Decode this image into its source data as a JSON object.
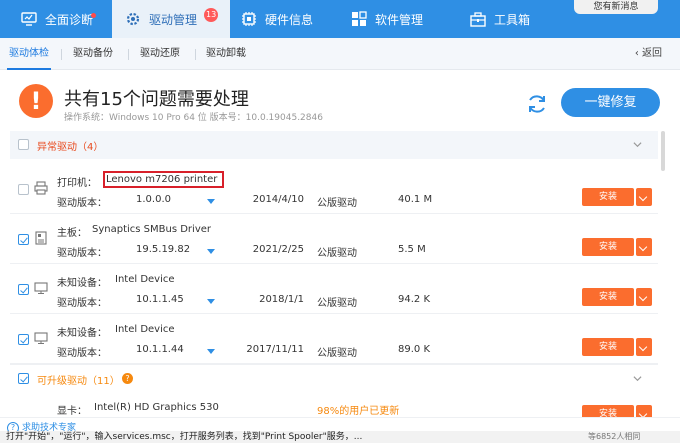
{
  "header": {
    "tabs": [
      {
        "label": "全面诊断",
        "icon": "monitor-icon"
      },
      {
        "label": "驱动管理",
        "icon": "gear-icon",
        "badge": "13"
      },
      {
        "label": "硬件信息",
        "icon": "chip-icon"
      },
      {
        "label": "软件管理",
        "icon": "grid-icon"
      },
      {
        "label": "工具箱",
        "icon": "toolbox-icon"
      }
    ],
    "message_button": "您有新消息"
  },
  "subnav": {
    "tabs": [
      "驱动体检",
      "驱动备份",
      "驱动还原",
      "驱动卸载"
    ],
    "active": "驱动体检",
    "back": "返回"
  },
  "summary": {
    "title": "共有15个问题需要处理",
    "os_info": "操作系统：Windows 10 Pro 64 位      版本号：10.0.19045.2846",
    "fix_button": "一键修复"
  },
  "categories": [
    {
      "label": "异常驱动（4）",
      "color": "#e84a1e"
    },
    {
      "label": "可升级驱动（11）",
      "color": "#f6890f"
    }
  ],
  "rows": [
    {
      "type": "打印机：",
      "name": "Lenovo m7206 printer",
      "version_label": "驱动版本：",
      "version": "1.0.0.0",
      "date": "2014/4/10",
      "driver": "公版驱动",
      "size": "40.1 M",
      "install": "安装",
      "icon": "printer-icon",
      "checked": false,
      "highlight": true
    },
    {
      "type": "主板：",
      "name": "Synaptics SMBus Driver",
      "version_label": "驱动版本：",
      "version": "19.5.19.82",
      "date": "2021/2/25",
      "driver": "公版驱动",
      "size": "5.5 M",
      "install": "安装",
      "icon": "board-icon",
      "checked": true
    },
    {
      "type": "未知设备：",
      "name": "Intel Device",
      "version_label": "驱动版本：",
      "version": "10.1.1.45",
      "date": "2018/1/1",
      "driver": "公版驱动",
      "size": "94.2 K",
      "install": "安装",
      "icon": "monitor-icon",
      "checked": true
    },
    {
      "type": "未知设备：",
      "name": "Intel Device",
      "version_label": "驱动版本：",
      "version": "10.1.1.44",
      "date": "2017/11/11",
      "driver": "公版驱动",
      "size": "89.0 K",
      "install": "安装",
      "icon": "monitor-icon",
      "checked": true
    },
    {
      "type": "显卡：",
      "name": "Intel(R) HD Graphics 530",
      "note": "98%的用户已更新",
      "install": "安装"
    }
  ],
  "footer": {
    "support": "求助技术专家",
    "outside_text": "打开\"开始\"，\"运行\"，输入services.msc，打开服务列表，找到\"Print Spooler\"服务，...",
    "users": "等6852人相同"
  },
  "colors": {
    "primary": "#2f8fe4",
    "install": "#fb6d2e",
    "warn": "#fb6d2e",
    "danger": "#e84a1e",
    "orange": "#f6890f"
  }
}
